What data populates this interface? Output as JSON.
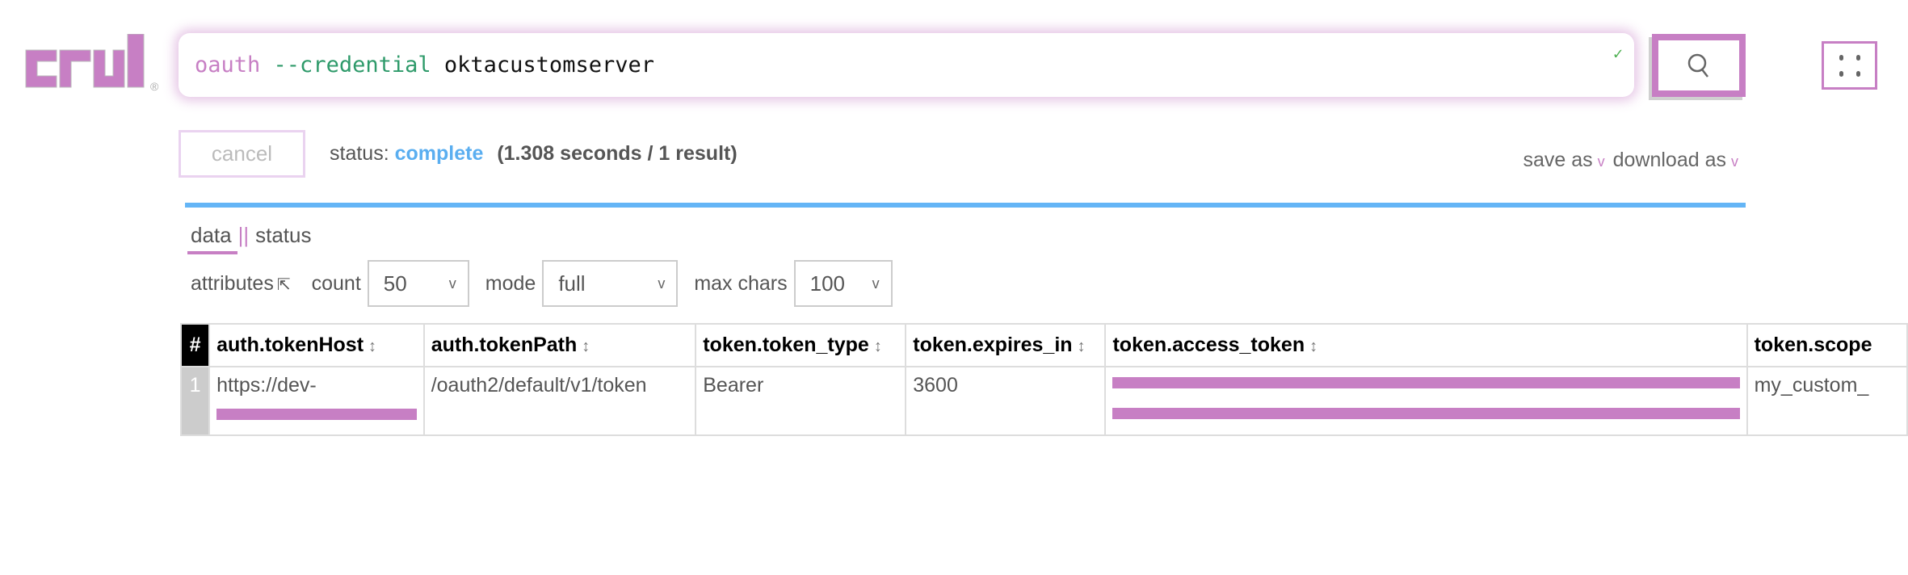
{
  "brand": {
    "logo_text": "crul",
    "registered": "®",
    "accent": "#c77fc4"
  },
  "query": {
    "command": "oauth",
    "flag": "--credential",
    "value": "oktacustomserver",
    "valid_icon": "check-icon"
  },
  "search_button": {
    "icon": "search-icon"
  },
  "menu_button": {
    "icon": "grid-dots-icon"
  },
  "run": {
    "cancel_label": "cancel",
    "status_label": "status:",
    "status_value": "complete",
    "status_color": "#5aaef0",
    "timing": "(1.308 seconds / 1 result)"
  },
  "exports": {
    "save_as": "save as",
    "download_as": "download as"
  },
  "tabs": [
    {
      "label": "data",
      "active": true
    },
    {
      "separator": "||"
    },
    {
      "label": "status"
    }
  ],
  "controls": {
    "attributes_label": "attributes",
    "attributes_icon": "expand-arrow-icon",
    "count_label": "count",
    "count_value": "50",
    "mode_label": "mode",
    "mode_value": "full",
    "max_chars_label": "max chars",
    "max_chars_value": "100"
  },
  "table": {
    "columns": [
      "#",
      "auth.tokenHost",
      "auth.tokenPath",
      "token.token_type",
      "token.expires_in",
      "token.access_token",
      "token.scope"
    ],
    "sort_icon": "↕",
    "rows": [
      {
        "index": "1",
        "tokenHost": "https://dev-",
        "tokenPath": "/oauth2/default/v1/token",
        "token_type": "Bearer",
        "expires_in": "3600",
        "access_token": "[redacted]",
        "scope": "my_custom_"
      }
    ]
  }
}
